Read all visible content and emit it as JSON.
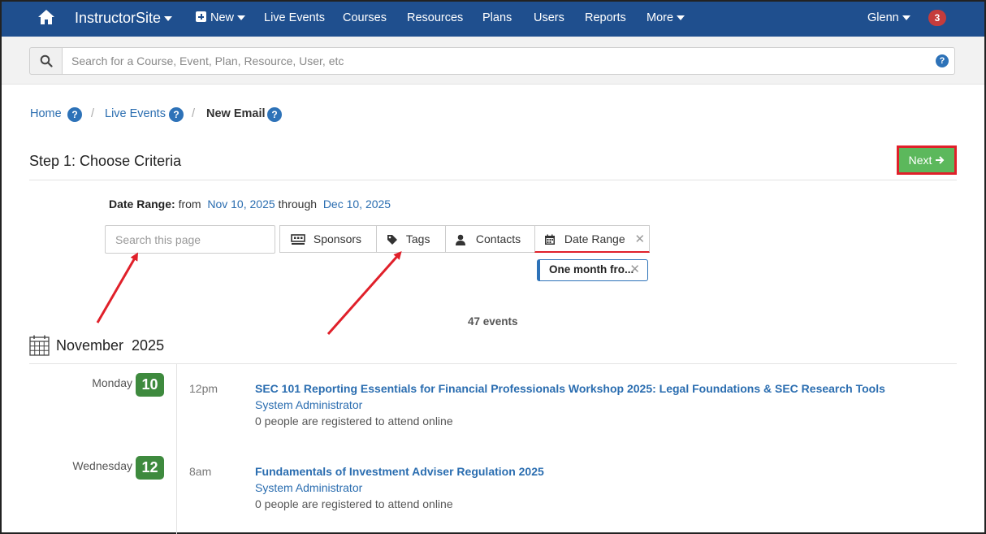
{
  "nav": {
    "brand": "InstructorSite",
    "new_label": "New",
    "items": [
      "Live Events",
      "Courses",
      "Resources",
      "Plans",
      "Users",
      "Reports"
    ],
    "more_label": "More",
    "user": "Glenn",
    "notification_count": "3"
  },
  "search": {
    "placeholder": "Search for a Course, Event, Plan, Resource, User, etc"
  },
  "breadcrumb": {
    "home": "Home",
    "live_events": "Live Events",
    "current": "New Email",
    "help": "?"
  },
  "step": {
    "title": "Step 1: Choose Criteria",
    "next_label": "Next"
  },
  "date_range": {
    "label": "Date Range:",
    "from_word": "from",
    "from": "Nov 10, 2025",
    "through_word": "through",
    "to": "Dec 10, 2025"
  },
  "filters": {
    "search_placeholder": "Search this page",
    "sponsors": "Sponsors",
    "tags": "Tags",
    "contacts": "Contacts",
    "date_range": "Date Range",
    "chip": "One month fro..."
  },
  "summary": {
    "count": "47 events"
  },
  "calendar": {
    "month": "November  2025",
    "events": [
      {
        "day_name": "Monday",
        "day_num": "10",
        "time": "12pm",
        "title": "SEC 101 Reporting Essentials for Financial Professionals Workshop 2025: Legal Foundations & SEC Research Tools",
        "host": "System Administrator",
        "registered": "0 people are registered to attend online"
      },
      {
        "day_name": "Wednesday",
        "day_num": "12",
        "time": "8am",
        "title": "Fundamentals of Investment Adviser Regulation 2025",
        "host": "System Administrator",
        "registered": "0 people are registered to attend online"
      }
    ]
  },
  "colors": {
    "nav_bg": "#1f4f8e",
    "link": "#2a6db0",
    "next_bg": "#5cb85c",
    "highlight": "#e0202a",
    "day_badge": "#3e8a3e"
  }
}
